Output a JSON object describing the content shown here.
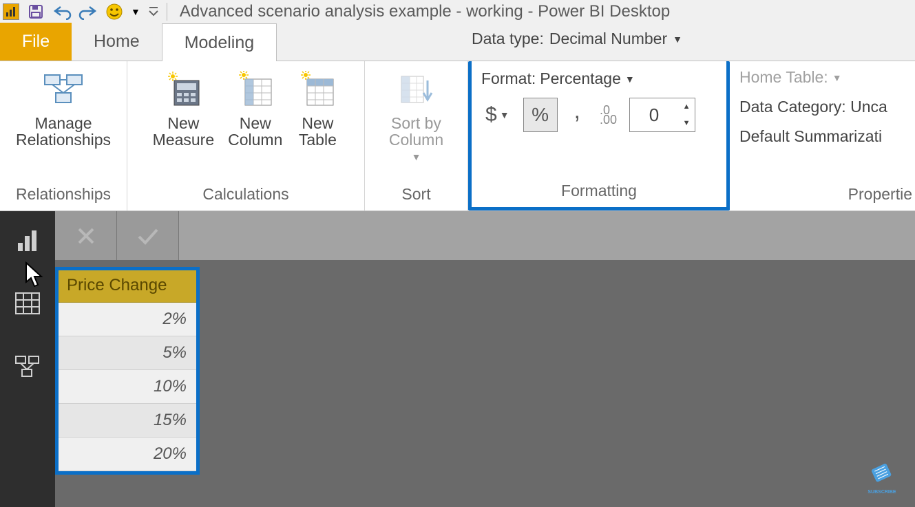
{
  "title": "Advanced scenario analysis example - working - Power BI Desktop",
  "tabs": {
    "file": "File",
    "home": "Home",
    "modeling": "Modeling"
  },
  "ribbon": {
    "relationships": {
      "btn": "Manage\nRelationships",
      "group": "Relationships"
    },
    "calculations": {
      "measure": "New\nMeasure",
      "column": "New\nColumn",
      "table": "New\nTable",
      "group": "Calculations"
    },
    "sort": {
      "btn": "Sort by\nColumn",
      "group": "Sort"
    },
    "formatting": {
      "datatype_label": "Data type:",
      "datatype_value": "Decimal Number",
      "format_label": "Format:",
      "format_value": "Percentage",
      "currency": "$",
      "percent": "%",
      "comma": ",",
      "decimals_icon": ".0\n.00",
      "decimals_value": "0",
      "group": "Formatting"
    },
    "properties": {
      "home_table": "Home Table:",
      "data_category": "Data Category: Unca",
      "default_summ": "Default Summarizati",
      "group": "Propertie"
    }
  },
  "table": {
    "header": "Price Change",
    "rows": [
      "2%",
      "5%",
      "10%",
      "15%",
      "20%"
    ]
  },
  "subscribe": "SUBSCRIBE"
}
